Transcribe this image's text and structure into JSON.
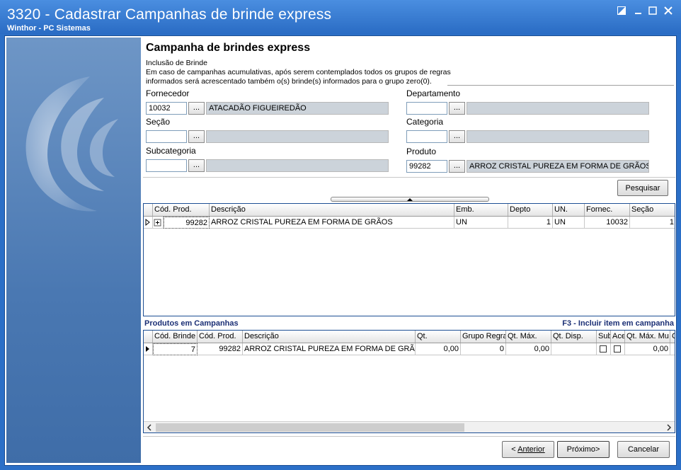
{
  "window": {
    "title": "3320 - Cadastrar Campanhas de brinde express",
    "subtitle": "Winthor - PC Sistemas"
  },
  "header": {
    "title": "Campanha de brindes express",
    "step": "Inclusão de Brinde",
    "info_line1": "Em caso de campanhas acumulativas, após serem contemplados todos os grupos de regras",
    "info_line2": "informados será acrescentado também o(s) brinde(s) informados para o grupo zero(0)."
  },
  "filters": {
    "fornecedor": {
      "label": "Fornecedor",
      "code": "10032",
      "name": "ATACADÃO FIGUEIREDÃO"
    },
    "departamento": {
      "label": "Departamento",
      "code": "",
      "name": ""
    },
    "secao": {
      "label": "Seção",
      "code": "",
      "name": ""
    },
    "categoria": {
      "label": "Categoria",
      "code": "",
      "name": ""
    },
    "subcategoria": {
      "label": "Subcategoria",
      "code": "",
      "name": ""
    },
    "produto": {
      "label": "Produto",
      "code": "99282",
      "name": "ARROZ  CRISTAL PUREZA EM FORMA DE GRÃOS"
    },
    "lookup_button": "...",
    "search_button": "Pesquisar"
  },
  "products_grid": {
    "columns": [
      "Cód. Prod.",
      "Descrição",
      "Emb.",
      "Depto",
      "UN.",
      "Fornec.",
      "Seção"
    ],
    "rows": [
      {
        "cod": "99282",
        "descricao": "ARROZ  CRISTAL PUREZA EM FORMA DE GRÃOS",
        "emb": "UN",
        "depto": "1",
        "un": "UN",
        "fornec": "10032",
        "secao": "1"
      }
    ]
  },
  "campaign_grid": {
    "title": "Produtos em Campanhas",
    "hint": "F3 - Incluir item em campanha",
    "columns": [
      "Cód. Brinde",
      "Cód. Prod.",
      "Descrição",
      "Qt.",
      "Grupo Regra",
      "Qt. Máx.",
      "Qt. Disp.",
      "Sub",
      "Ace",
      "Qt. Máx. Mu",
      "C"
    ],
    "rows": [
      {
        "cod_brinde": "7",
        "cod_prod": "99282",
        "descricao": "ARROZ  CRISTAL PUREZA EM FORMA DE GRÃOS",
        "qt": "0,00",
        "grupo": "0",
        "qt_max": "0,00",
        "qt_disp": "",
        "qt_max_mu": "0,00"
      }
    ]
  },
  "footer": {
    "prev": "Anterior",
    "next": "Próximo>",
    "cancel": "Cancelar"
  },
  "colors": {
    "title_bar": "#2a6cc4",
    "side_panel": "#4a78b2",
    "section_header": "#1b2f75"
  }
}
